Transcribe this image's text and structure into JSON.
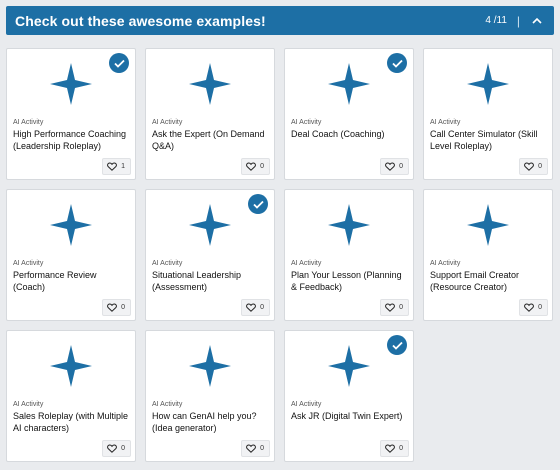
{
  "banner": {
    "title": "Check out these awesome examples!",
    "count": "4 /11",
    "separator": "|"
  },
  "colors": {
    "accent": "#1d6fa5",
    "background": "#e9ebee",
    "card": "#ffffff"
  },
  "cards": [
    {
      "kind": "AI Activity",
      "title": "High Performance Coaching (Leadership Roleplay)",
      "likes": "1",
      "completed": true
    },
    {
      "kind": "AI Activity",
      "title": "Ask the Expert (On Demand Q&A)",
      "likes": "0",
      "completed": false
    },
    {
      "kind": "AI Activity",
      "title": "Deal Coach  (Coaching)",
      "likes": "0",
      "completed": true
    },
    {
      "kind": "AI Activity",
      "title": "Call Center Simulator (Skill Level Roleplay)",
      "likes": "0",
      "completed": false
    },
    {
      "kind": "AI Activity",
      "title": "Performance Review (Coach)",
      "likes": "0",
      "completed": false
    },
    {
      "kind": "AI Activity",
      "title": "Situational Leadership (Assessment)",
      "likes": "0",
      "completed": true
    },
    {
      "kind": "AI Activity",
      "title": "Plan Your Lesson (Planning & Feedback)",
      "likes": "0",
      "completed": false
    },
    {
      "kind": "AI Activity",
      "title": "Support Email Creator (Resource Creator)",
      "likes": "0",
      "completed": false
    },
    {
      "kind": "AI Activity",
      "title": "Sales Roleplay (with Multiple AI characters)",
      "likes": "0",
      "completed": false
    },
    {
      "kind": "AI Activity",
      "title": "How can GenAI help you? (Idea generator)",
      "likes": "0",
      "completed": false
    },
    {
      "kind": "AI Activity",
      "title": "Ask JR (Digital Twin Expert)",
      "likes": "0",
      "completed": true
    }
  ],
  "icons": {
    "card_image": "four-point-star-icon",
    "completed": "check-circle-icon",
    "like": "heart-icon",
    "collapse": "chevron-up-icon"
  }
}
